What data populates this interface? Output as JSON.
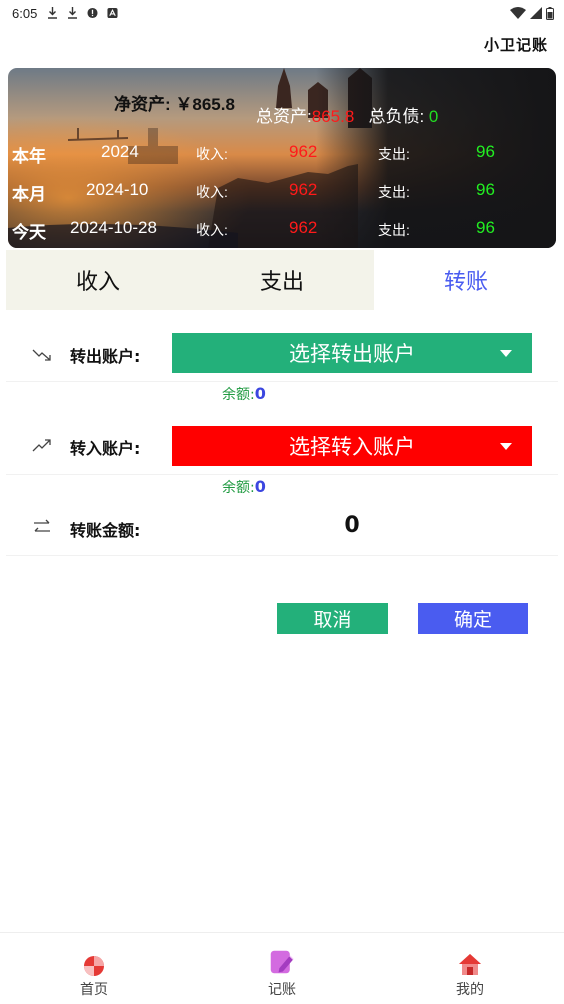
{
  "status_bar": {
    "time": "6:05",
    "icons": [
      "download-icon",
      "download-icon",
      "alert-icon",
      "a-icon"
    ],
    "right_icons": [
      "wifi-icon",
      "signal-icon",
      "battery-icon"
    ]
  },
  "app_title": "小卫记账",
  "summary": {
    "net_assets": "净资产: ￥865.8",
    "total_assets_label": "总资产:",
    "total_assets_value": "865.8",
    "total_debt_label": "总负债:",
    "total_debt_value": "0",
    "rows": [
      {
        "label": "本年",
        "date": "2024",
        "income_label": "收入:",
        "income": "962",
        "expense_label": "支出:",
        "expense": "96"
      },
      {
        "label": "本月",
        "date": "2024-10",
        "income_label": "收入:",
        "income": "962",
        "expense_label": "支出:",
        "expense": "96"
      },
      {
        "label": "今天",
        "date": "2024-10-28",
        "income_label": "收入:",
        "income": "962",
        "expense_label": "支出:",
        "expense": "96"
      }
    ]
  },
  "tabs": [
    {
      "label": "收入",
      "active": false
    },
    {
      "label": "支出",
      "active": false
    },
    {
      "label": "转账",
      "active": true
    }
  ],
  "form": {
    "from": {
      "icon": "trending-down-icon",
      "label": "转出账户:",
      "select": "选择转出账户",
      "balance_label": "余额:",
      "balance": "0",
      "color": "#23b07a"
    },
    "to": {
      "icon": "trending-up-icon",
      "label": "转入账户:",
      "select": "选择转入账户",
      "balance_label": "余额:",
      "balance": "0",
      "color": "#ff0000"
    },
    "amount": {
      "icon": "swap-icon",
      "label": "转账金额:",
      "value": "0"
    }
  },
  "buttons": {
    "cancel": "取消",
    "confirm": "确定"
  },
  "bottom_nav": [
    {
      "label": "首页",
      "icon": "pie-chart-icon"
    },
    {
      "label": "记账",
      "icon": "notebook-pen-icon"
    },
    {
      "label": "我的",
      "icon": "home-icon"
    }
  ],
  "colors": {
    "accent": "#4a5cf0",
    "income_red": "#ff1a1a",
    "expense_green": "#22ee22",
    "cancel_green": "#23b07a"
  }
}
